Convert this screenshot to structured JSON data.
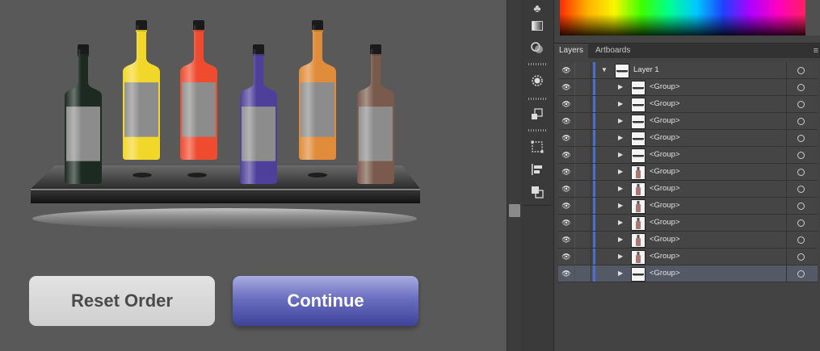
{
  "canvas": {
    "buttons": {
      "reset_label": "Reset Order",
      "continue_label": "Continue"
    },
    "bottles": [
      {
        "color": "#1c2a22",
        "name": "dark-green-bottle"
      },
      {
        "color": "#f2d72b",
        "name": "yellow-bottle"
      },
      {
        "color": "#ef4c2f",
        "name": "red-bottle"
      },
      {
        "color": "#4d3f9a",
        "name": "purple-bottle"
      },
      {
        "color": "#e08c3a",
        "name": "orange-bottle"
      },
      {
        "color": "#7a5a4c",
        "name": "brown-bottle"
      }
    ]
  },
  "panel": {
    "tabs": [
      "Layers",
      "Artboards"
    ],
    "active_tab": "Layers",
    "layer": {
      "name": "Layer 1"
    },
    "groups": [
      {
        "name": "<Group>",
        "thumb": "bar"
      },
      {
        "name": "<Group>",
        "thumb": "bar"
      },
      {
        "name": "<Group>",
        "thumb": "bar"
      },
      {
        "name": "<Group>",
        "thumb": "bar"
      },
      {
        "name": "<Group>",
        "thumb": "bar"
      },
      {
        "name": "<Group>",
        "thumb": "bottle"
      },
      {
        "name": "<Group>",
        "thumb": "bottle"
      },
      {
        "name": "<Group>",
        "thumb": "bottle"
      },
      {
        "name": "<Group>",
        "thumb": "bottle"
      },
      {
        "name": "<Group>",
        "thumb": "bottle"
      },
      {
        "name": "<Group>",
        "thumb": "bottle"
      },
      {
        "name": "<Group>",
        "thumb": "bar"
      }
    ]
  },
  "colors": {
    "selection_bar": "#4b6fd1",
    "continue_button": "#5a5fb5",
    "reset_button": "#d8d8d8"
  }
}
